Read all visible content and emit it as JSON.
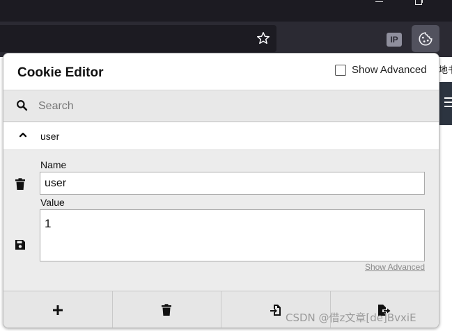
{
  "popup": {
    "title": "Cookie Editor",
    "show_advanced_label": "Show Advanced",
    "search_placeholder": "Search",
    "cookie": {
      "name": "user",
      "name_label": "Name",
      "value_label": "Value",
      "name_value": "user",
      "value_value": "1",
      "show_advanced_link": "Show Advanced"
    },
    "footer_icons": [
      "plus-icon",
      "trash-icon",
      "import-icon",
      "export-icon"
    ]
  },
  "browser": {
    "ip_badge": "IP",
    "page_fragment": "地书"
  },
  "watermark": "CSDN @借z文章[de]BvxiE"
}
